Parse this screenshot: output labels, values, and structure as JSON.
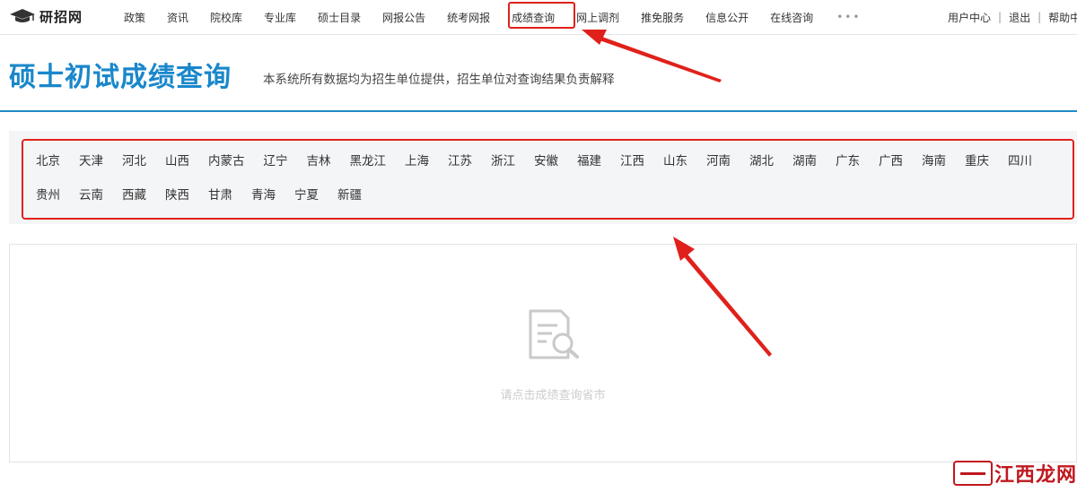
{
  "header": {
    "logo_text": "研招网",
    "nav": [
      "政策",
      "资讯",
      "院校库",
      "专业库",
      "硕士目录",
      "网报公告",
      "统考网报",
      "成绩查询",
      "网上调剂",
      "推免服务",
      "信息公开",
      "在线咨询"
    ],
    "active_nav": "成绩查询",
    "more": "•••",
    "user_center": "用户中心",
    "logout": "退出",
    "help": "帮助中",
    "separator": "|"
  },
  "page": {
    "title": "硕士初试成绩查询",
    "subtitle": "本系统所有数据均为招生单位提供，招生单位对查询结果负责解释"
  },
  "provinces": {
    "row1": [
      "北京",
      "天津",
      "河北",
      "山西",
      "内蒙古",
      "辽宁",
      "吉林",
      "黑龙江",
      "上海",
      "江苏",
      "浙江",
      "安徽",
      "福建",
      "江西",
      "山东",
      "河南",
      "湖北",
      "湖南",
      "广东",
      "广西",
      "海南",
      "重庆",
      "四川"
    ],
    "row2": [
      "贵州",
      "云南",
      "西藏",
      "陕西",
      "甘肃",
      "青海",
      "宁夏",
      "新疆"
    ]
  },
  "result": {
    "empty_text": "请点击成绩查询省市",
    "icon": "document-search-icon"
  },
  "watermark": {
    "text": "江西龙网"
  },
  "colors": {
    "title_blue": "#1a87cb",
    "annotation_red": "#e0211b",
    "panel_bg": "#f4f5f7"
  }
}
